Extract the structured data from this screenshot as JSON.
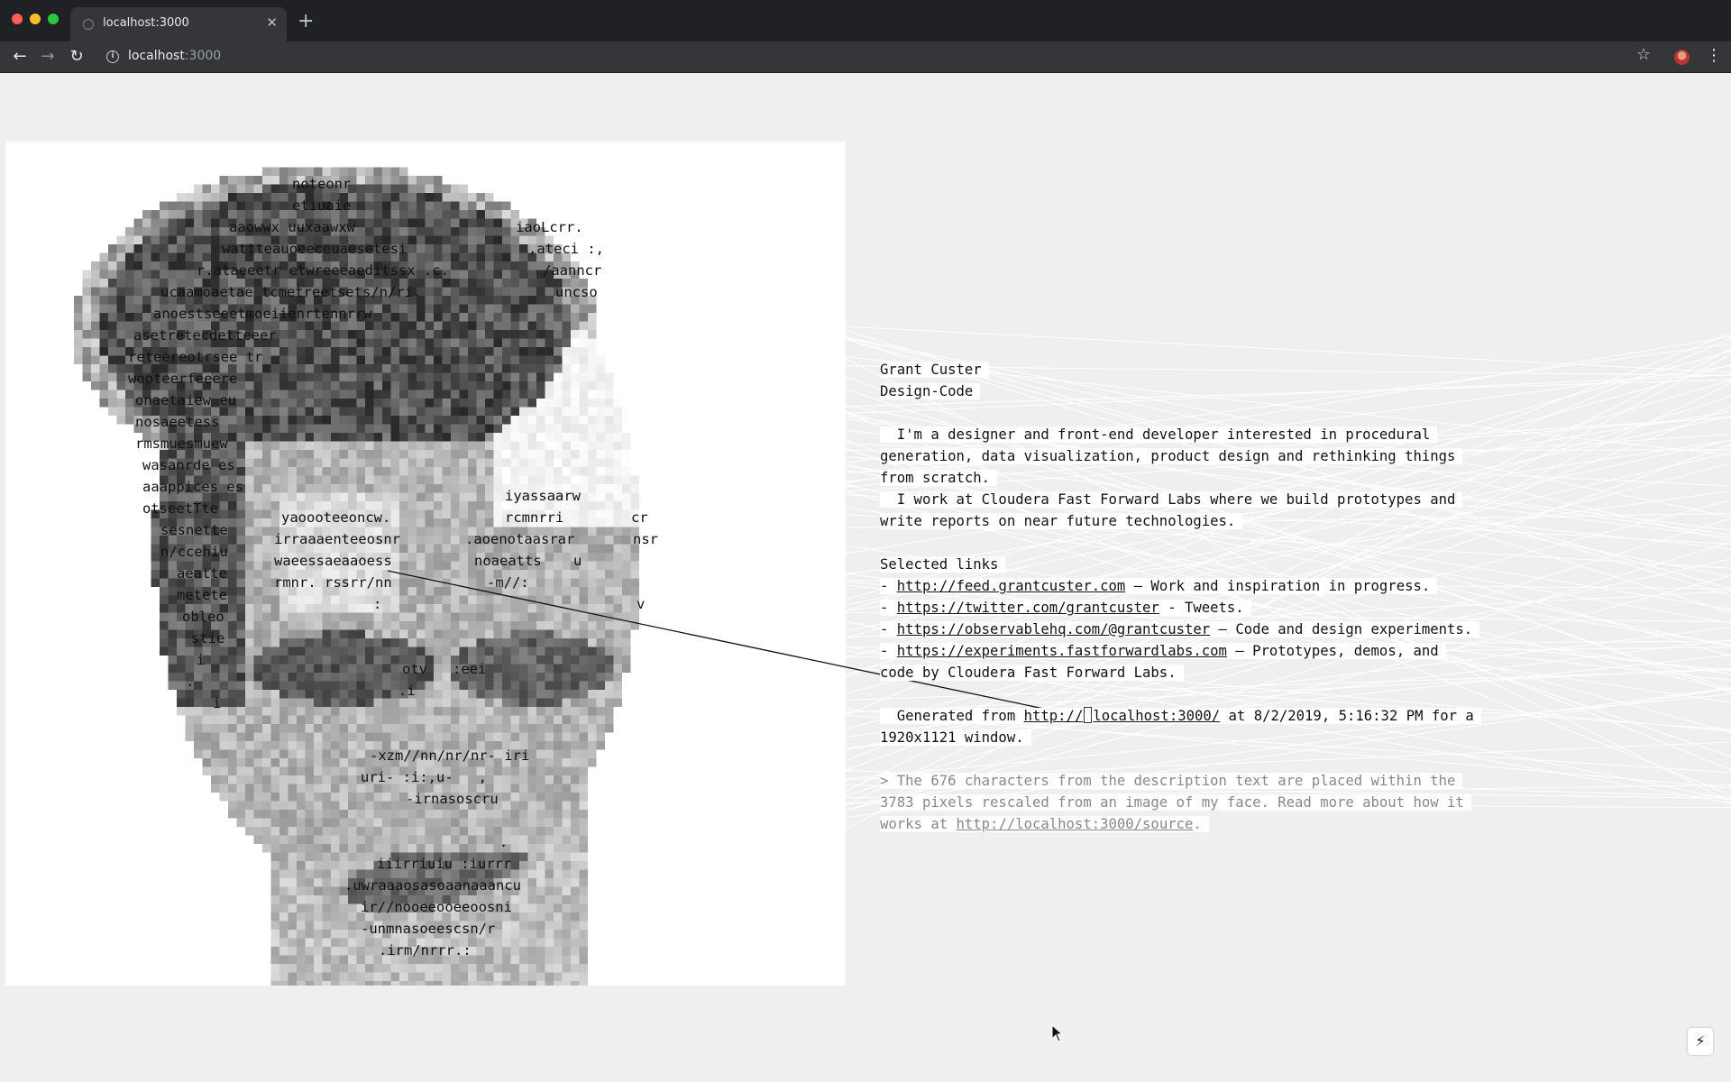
{
  "browser": {
    "tab_title": "localhost:3000",
    "url_host": "localhost",
    "url_port": ":3000"
  },
  "portrait_glyphs": [
    "noteonr",
    "etiuaie",
    "aaowwx uuxaawxw",
    "wattteauoeeceuaesetesi",
    "r.ataeeetr etwreeeaeditssx .c.",
    "ucaamoaetae tcmetreetsets/n/ri.",
    "anoestseeetmoeiienrtennrrw",
    "asetretecdetteeer",
    "reteereotrsee tr",
    "wooteerfeeere",
    "onaetaiew eu",
    "nosaeetess",
    "rmsmuesmuew",
    "wasanrde es",
    "aaappices es",
    "otseetTte",
    "sesnette",
    "n/ccehiu",
    "aeatte",
    "metete",
    "obleo",
    "stie",
    "i",
    ".",
    "i",
    "iaoLcrr.",
    ",ateci :,",
    "/aanncr",
    "uncso",
    "iyassaarw",
    "yaoooteeoncw.",
    "rcmnrri",
    "cr",
    "irraaaenteeosnr",
    ".aoenotaasrar",
    "nsr",
    "waeessaeaaoess",
    "noaeatts",
    "u",
    "rmnr. rssrr/nn",
    "-m//:",
    ":",
    "v",
    "otv   :eei",
    ".i",
    "-xzm//nn/nr/nr- iri",
    "uri- :i:,u-   ,",
    "-irnasoscru",
    ".",
    "iiirriuiu :iurrr",
    ".uwraaaosasoaanaaancu",
    "ir//nooeeooeeoosni",
    "-unmnasoeescsn/r",
    ".irm/nrrr.:"
  ],
  "profile": {
    "name": "Grant Custer",
    "role": "Design-Code",
    "bio_1": "  I'm a designer and front-end developer interested in procedural",
    "bio_2": "generation, data visualization, product design and rethinking things",
    "bio_3": "from scratch.",
    "bio_4": "  I work at Cloudera Fast Forward Labs where we build prototypes and",
    "bio_5": "write reports on near future technologies."
  },
  "links": {
    "heading": "Selected links",
    "items": [
      {
        "prefix": "- ",
        "url": "http://feed.grantcuster.com",
        "desc": " – Work and inspiration in progress."
      },
      {
        "prefix": "- ",
        "url": "https://twitter.com/grantcuster",
        "desc": " - Tweets."
      },
      {
        "prefix": "- ",
        "url": "https://observablehq.com/@grantcuster",
        "desc": " – Code and design experiments."
      },
      {
        "prefix": "- ",
        "url": "https://experiments.fastforwardlabs.com",
        "desc": " – Prototypes, demos, and"
      }
    ],
    "continuation": "code by Cloudera Fast Forward Labs."
  },
  "generated": {
    "prefix": "  Generated from ",
    "url_a": "http://",
    "url_b": "localhost:3000/",
    "suffix": " at 8/2/2019, 5:16:32 PM for a",
    "line2": "1920x1121 window."
  },
  "note": {
    "line1": "> The 676 characters from the description text are placed within the",
    "line2": "3783 pixels rescaled from an image of my face. Read more about how it",
    "line3_prefix": "works at ",
    "line3_url": "http://localhost:3000/source",
    "line3_suffix": "."
  }
}
